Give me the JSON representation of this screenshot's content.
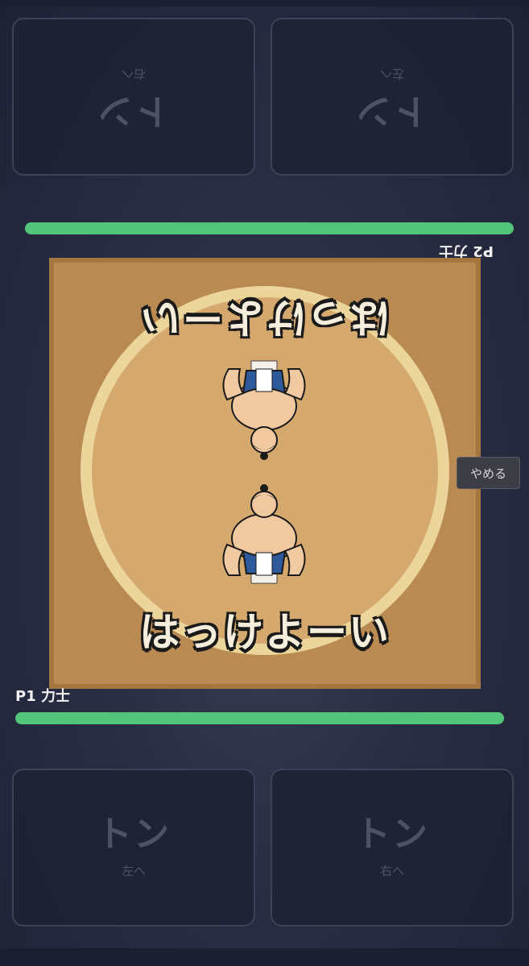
{
  "player2": {
    "name": "P2 力士",
    "hp": 1.0,
    "pads": [
      {
        "action": "トン",
        "direction": "右へ"
      },
      {
        "action": "トン",
        "direction": "左へ"
      }
    ]
  },
  "player1": {
    "name": "P1 力士",
    "hp": 1.0,
    "pads": [
      {
        "action": "トン",
        "direction": "左へ"
      },
      {
        "action": "トン",
        "direction": "右へ"
      }
    ]
  },
  "arena": {
    "call_top": "はっけよーい",
    "call_bottom": "はっけよーい"
  },
  "quit_label": "やめる",
  "colors": {
    "hp_bar": "#52c57a",
    "dohyo": "#b98b52",
    "ring": "#ecd59a",
    "ring_floor": "#d5a96e"
  }
}
